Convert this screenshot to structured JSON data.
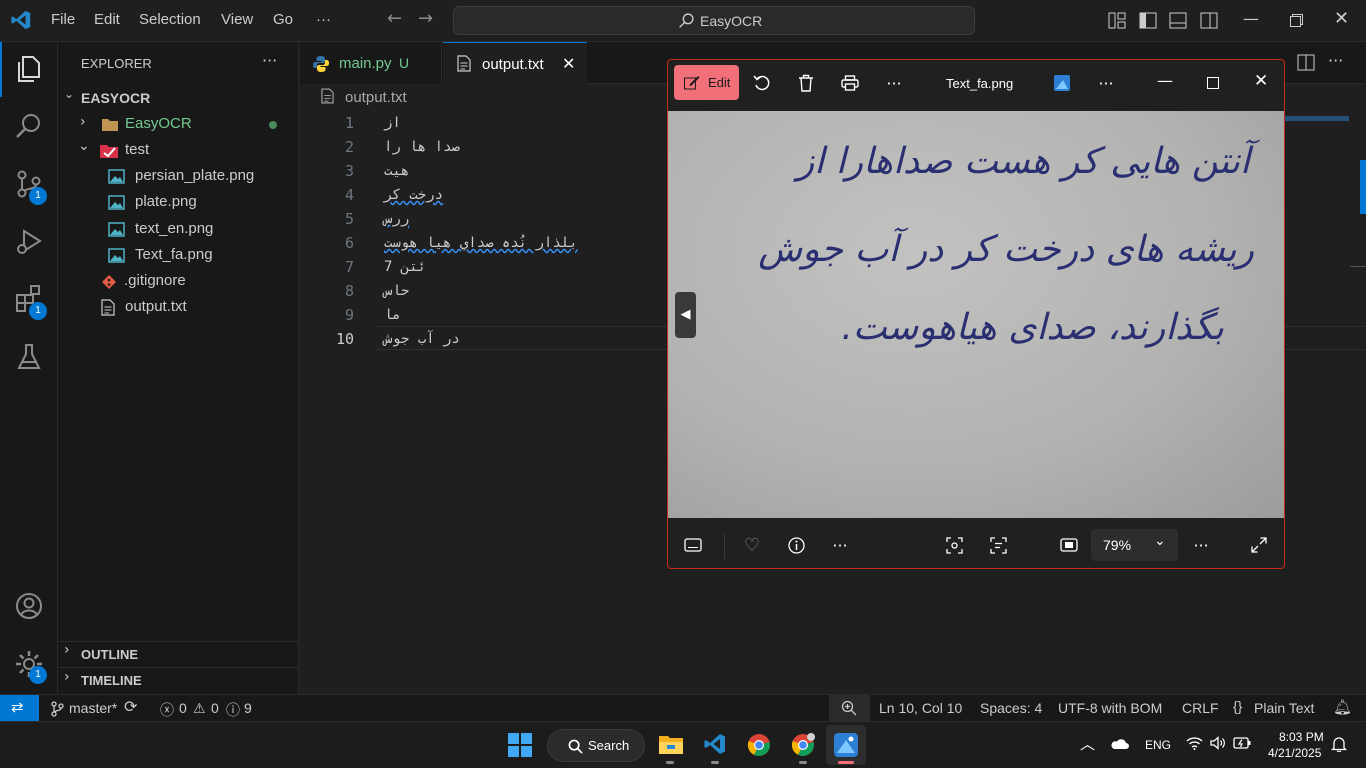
{
  "titlebar": {
    "menu": [
      "File",
      "Edit",
      "Selection",
      "View",
      "Go",
      "···"
    ],
    "search_text": "EasyOCR"
  },
  "activitybar": {
    "scm_badge": "1",
    "extensions_badge": "1",
    "settings_badge": "1"
  },
  "sidebar": {
    "title": "EXPLORER",
    "more": "···",
    "root": "EASYOCR",
    "items": [
      {
        "label": "EasyOCR"
      },
      {
        "label": "test"
      },
      {
        "label": "persian_plate.png"
      },
      {
        "label": "plate.png"
      },
      {
        "label": "text_en.png"
      },
      {
        "label": "Text_fa.png"
      },
      {
        "label": ".gitignore"
      },
      {
        "label": "output.txt"
      }
    ],
    "outline": "OUTLINE",
    "timeline": "TIMELINE"
  },
  "tabs": [
    {
      "label": "main.py",
      "status": "U"
    },
    {
      "label": "output.txt",
      "close": "✕"
    }
  ],
  "breadcrumb": "output.txt",
  "editor": {
    "lines": [
      {
        "num": "1",
        "text": "از"
      },
      {
        "num": "2",
        "text": "صدا ها را"
      },
      {
        "num": "3",
        "text": "هیت"
      },
      {
        "num": "4",
        "text": "درخت کر"
      },
      {
        "num": "5",
        "text": "ررس"
      },
      {
        "num": "6",
        "text": "بلذار نُدہ صداي هیا هوست"
      },
      {
        "num": "7",
        "text": "ئتن 7"
      },
      {
        "num": "8",
        "text": "حاس"
      },
      {
        "num": "9",
        "text": "ما"
      },
      {
        "num": "10",
        "text": "در آب جوش"
      }
    ]
  },
  "photos": {
    "edit_label": "Edit",
    "filename": "Text_fa.png",
    "zoom": "79%",
    "handwriting": [
      "آنتن هایی کر هست صداهارا از",
      "ریشه های درخت کر در آب جوش",
      "بگذارند، صدای هیاهوست."
    ]
  },
  "statusbar": {
    "branch": "master*",
    "errors": "0",
    "warnings": "0",
    "info": "9",
    "position": "Ln 10, Col 10",
    "spaces": "Spaces: 4",
    "encoding": "UTF-8 with BOM",
    "eol": "CRLF",
    "language": "Plain Text"
  },
  "taskbar": {
    "search_label": "Search",
    "lang": "ENG",
    "time": "8:03 PM",
    "date": "4/21/2025"
  },
  "colors": {
    "accent": "#0078d4",
    "edit_button": "#f1707a",
    "modified_dot": "#73c991",
    "close_red": "#c42b1c"
  }
}
